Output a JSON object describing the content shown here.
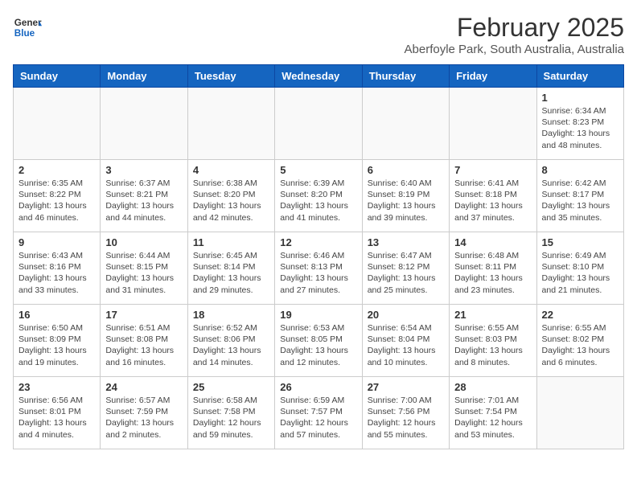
{
  "header": {
    "logo_general": "General",
    "logo_blue": "Blue",
    "main_title": "February 2025",
    "subtitle": "Aberfoyle Park, South Australia, Australia"
  },
  "weekdays": [
    "Sunday",
    "Monday",
    "Tuesday",
    "Wednesday",
    "Thursday",
    "Friday",
    "Saturday"
  ],
  "weeks": [
    [
      {
        "day": "",
        "info": ""
      },
      {
        "day": "",
        "info": ""
      },
      {
        "day": "",
        "info": ""
      },
      {
        "day": "",
        "info": ""
      },
      {
        "day": "",
        "info": ""
      },
      {
        "day": "",
        "info": ""
      },
      {
        "day": "1",
        "info": "Sunrise: 6:34 AM\nSunset: 8:23 PM\nDaylight: 13 hours\nand 48 minutes."
      }
    ],
    [
      {
        "day": "2",
        "info": "Sunrise: 6:35 AM\nSunset: 8:22 PM\nDaylight: 13 hours\nand 46 minutes."
      },
      {
        "day": "3",
        "info": "Sunrise: 6:37 AM\nSunset: 8:21 PM\nDaylight: 13 hours\nand 44 minutes."
      },
      {
        "day": "4",
        "info": "Sunrise: 6:38 AM\nSunset: 8:20 PM\nDaylight: 13 hours\nand 42 minutes."
      },
      {
        "day": "5",
        "info": "Sunrise: 6:39 AM\nSunset: 8:20 PM\nDaylight: 13 hours\nand 41 minutes."
      },
      {
        "day": "6",
        "info": "Sunrise: 6:40 AM\nSunset: 8:19 PM\nDaylight: 13 hours\nand 39 minutes."
      },
      {
        "day": "7",
        "info": "Sunrise: 6:41 AM\nSunset: 8:18 PM\nDaylight: 13 hours\nand 37 minutes."
      },
      {
        "day": "8",
        "info": "Sunrise: 6:42 AM\nSunset: 8:17 PM\nDaylight: 13 hours\nand 35 minutes."
      }
    ],
    [
      {
        "day": "9",
        "info": "Sunrise: 6:43 AM\nSunset: 8:16 PM\nDaylight: 13 hours\nand 33 minutes."
      },
      {
        "day": "10",
        "info": "Sunrise: 6:44 AM\nSunset: 8:15 PM\nDaylight: 13 hours\nand 31 minutes."
      },
      {
        "day": "11",
        "info": "Sunrise: 6:45 AM\nSunset: 8:14 PM\nDaylight: 13 hours\nand 29 minutes."
      },
      {
        "day": "12",
        "info": "Sunrise: 6:46 AM\nSunset: 8:13 PM\nDaylight: 13 hours\nand 27 minutes."
      },
      {
        "day": "13",
        "info": "Sunrise: 6:47 AM\nSunset: 8:12 PM\nDaylight: 13 hours\nand 25 minutes."
      },
      {
        "day": "14",
        "info": "Sunrise: 6:48 AM\nSunset: 8:11 PM\nDaylight: 13 hours\nand 23 minutes."
      },
      {
        "day": "15",
        "info": "Sunrise: 6:49 AM\nSunset: 8:10 PM\nDaylight: 13 hours\nand 21 minutes."
      }
    ],
    [
      {
        "day": "16",
        "info": "Sunrise: 6:50 AM\nSunset: 8:09 PM\nDaylight: 13 hours\nand 19 minutes."
      },
      {
        "day": "17",
        "info": "Sunrise: 6:51 AM\nSunset: 8:08 PM\nDaylight: 13 hours\nand 16 minutes."
      },
      {
        "day": "18",
        "info": "Sunrise: 6:52 AM\nSunset: 8:06 PM\nDaylight: 13 hours\nand 14 minutes."
      },
      {
        "day": "19",
        "info": "Sunrise: 6:53 AM\nSunset: 8:05 PM\nDaylight: 13 hours\nand 12 minutes."
      },
      {
        "day": "20",
        "info": "Sunrise: 6:54 AM\nSunset: 8:04 PM\nDaylight: 13 hours\nand 10 minutes."
      },
      {
        "day": "21",
        "info": "Sunrise: 6:55 AM\nSunset: 8:03 PM\nDaylight: 13 hours\nand 8 minutes."
      },
      {
        "day": "22",
        "info": "Sunrise: 6:55 AM\nSunset: 8:02 PM\nDaylight: 13 hours\nand 6 minutes."
      }
    ],
    [
      {
        "day": "23",
        "info": "Sunrise: 6:56 AM\nSunset: 8:01 PM\nDaylight: 13 hours\nand 4 minutes."
      },
      {
        "day": "24",
        "info": "Sunrise: 6:57 AM\nSunset: 7:59 PM\nDaylight: 13 hours\nand 2 minutes."
      },
      {
        "day": "25",
        "info": "Sunrise: 6:58 AM\nSunset: 7:58 PM\nDaylight: 12 hours\nand 59 minutes."
      },
      {
        "day": "26",
        "info": "Sunrise: 6:59 AM\nSunset: 7:57 PM\nDaylight: 12 hours\nand 57 minutes."
      },
      {
        "day": "27",
        "info": "Sunrise: 7:00 AM\nSunset: 7:56 PM\nDaylight: 12 hours\nand 55 minutes."
      },
      {
        "day": "28",
        "info": "Sunrise: 7:01 AM\nSunset: 7:54 PM\nDaylight: 12 hours\nand 53 minutes."
      },
      {
        "day": "",
        "info": ""
      }
    ]
  ]
}
